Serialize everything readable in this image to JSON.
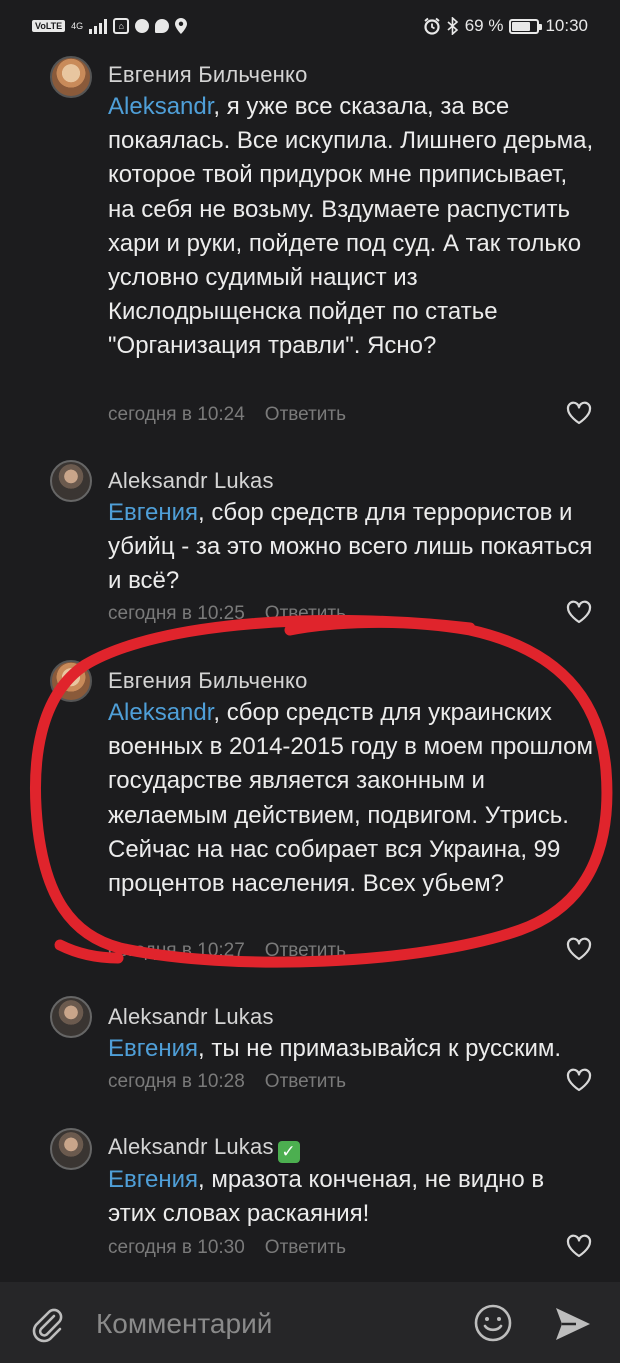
{
  "status_bar": {
    "network_badge": "VoLTE",
    "network_gen": "4G",
    "icons": [
      "sim-icon",
      "signal-icon",
      "lock-app-icon",
      "shield-icon",
      "chat-bubble-icon",
      "location-icon",
      "alarm-icon",
      "bluetooth-icon"
    ],
    "battery_text": "69 %",
    "battery_level": 0.69,
    "time": "10:30"
  },
  "comments": [
    {
      "author": "Евгения Бильченко",
      "mention": "Aleksandr",
      "text": ", я уже все сказала, за все покаялась. Все искупила. Лишнего дерьма, которое твой придурок мне приписывает, на себя не возьму. Вздумаете распустить хари и руки, пойдете под суд. А так только условно судимый нацист из Кислодрыщенска пойдет по статье \"Организация травли\". Ясно?",
      "time": "сегодня в 10:24",
      "reply_label": "Ответить",
      "verified": false
    },
    {
      "author": "Aleksandr Lukas",
      "mention": "Евгения",
      "text": ", сбор средств для террористов и убийц - за это можно всего лишь покаяться и всё?",
      "time": "сегодня в 10:25",
      "reply_label": "Ответить",
      "verified": false
    },
    {
      "author": "Евгения Бильченко",
      "mention": "Aleksandr",
      "text": ", сбор средств для украинских военных в 2014-2015 году в моем прошлом государстве является законным и желаемым действием, подвигом. Утрись. Сейчас на нас собирает вся Украина, 99 процентов населения. Всех убьем?",
      "time": "сегодня в 10:27",
      "reply_label": "Ответить",
      "verified": false
    },
    {
      "author": "Aleksandr Lukas",
      "mention": "Евгения",
      "text": ", ты не примазывайся к русским.",
      "time": "сегодня в 10:28",
      "reply_label": "Ответить",
      "verified": false
    },
    {
      "author": "Aleksandr Lukas",
      "mention": "Евгения",
      "text": ", мразота конченая, не видно в этих словах раскаяния!",
      "time": "сегодня в 10:30",
      "reply_label": "Ответить",
      "verified": true,
      "verified_glyph": "✓"
    }
  ],
  "composer": {
    "placeholder": "Комментарий",
    "value": ""
  },
  "colors": {
    "background": "#1c1c1e",
    "mention": "#4f9fd8",
    "meta": "#7a7a7a",
    "highlight_circle": "#e0242c",
    "verified": "#4caf50"
  }
}
